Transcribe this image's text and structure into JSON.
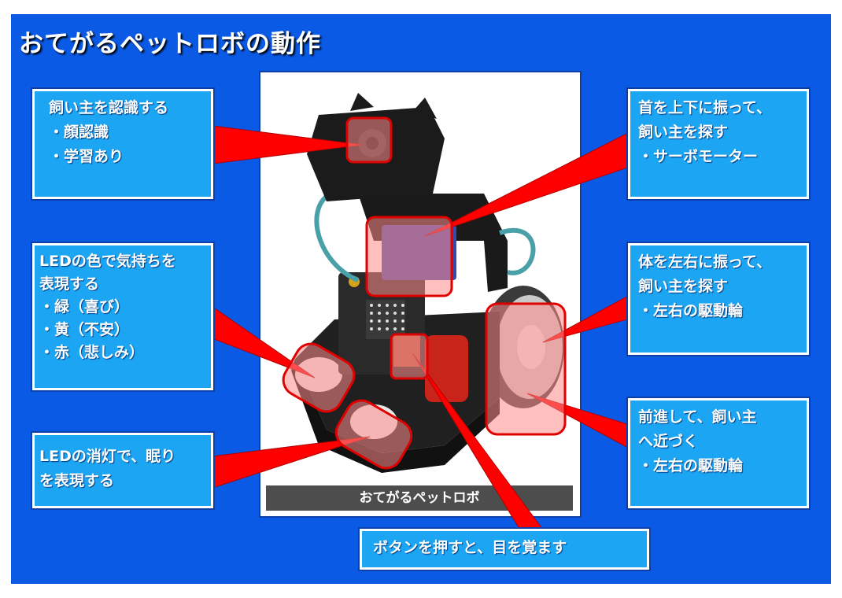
{
  "title": "おてがるペットロボの動作",
  "caption": "おてがるペットロボ",
  "callouts": {
    "recognize": [
      "飼い主を認識する",
      "・顔認識",
      "・学習あり"
    ],
    "led_color": [
      "LEDの色で気持ちを",
      "表現する",
      "・緑（喜び）",
      "・黄（不安）",
      "・赤（悲しみ）"
    ],
    "led_off": [
      "LEDの消灯で、眠り",
      "を表現する"
    ],
    "neck": [
      "首を上下に振って、",
      "飼い主を探す",
      "・サーボモーター"
    ],
    "body": [
      "体を左右に振って、",
      "飼い主を探す",
      "・左右の駆動輪"
    ],
    "forward": [
      "前進して、飼い主",
      "へ近づく",
      "・左右の駆動輪"
    ],
    "button": "ボタンを押すと、目を覚ます"
  },
  "colors": {
    "background": "#0a5ae6",
    "callout_fill": "#1ba5f2",
    "pointer": "#ff0000",
    "highlight": "#ff8a8a"
  }
}
